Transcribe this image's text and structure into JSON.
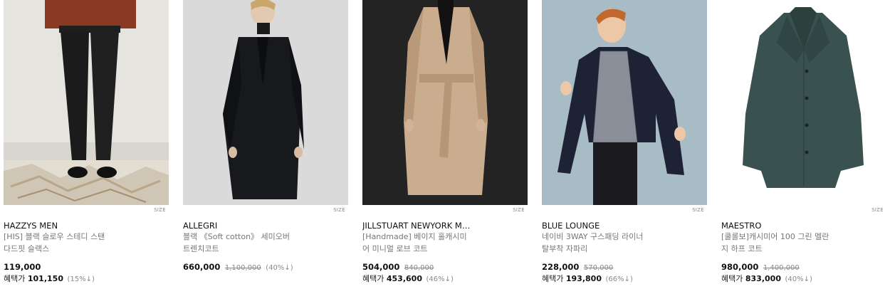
{
  "products": [
    {
      "brand": "HAZZYS MEN",
      "name_line1": "[HIS] 블랙 슬로우 스테디 스탠",
      "name_line2": "다드핏 슬랙스",
      "price": "119,000",
      "original_price": "",
      "discount_rate": "",
      "benefit_label": "혜택가",
      "benefit_price": "101,150",
      "benefit_rate": "(15%↓)",
      "size_tag": "SIZE",
      "image_bg": "#e7e5e0"
    },
    {
      "brand": "ALLEGRI",
      "name_line1": "블랙 《Soft cotton》 세미오버",
      "name_line2": "트렌치코트",
      "price": "660,000",
      "original_price": "1,100,000",
      "discount_rate": "(40%↓)",
      "benefit_label": "",
      "benefit_price": "",
      "benefit_rate": "",
      "size_tag": "SIZE",
      "image_bg": "#d8d9d8"
    },
    {
      "brand": "JILLSTUART NEWYORK M…",
      "name_line1": "[Handmade] 베이지 홀캐시미",
      "name_line2": "어 미니멀 로브 코트",
      "price": "504,000",
      "original_price": "840,000",
      "discount_rate": "",
      "benefit_label": "혜택가",
      "benefit_price": "453,600",
      "benefit_rate": "(46%↓)",
      "size_tag": "SIZE",
      "image_bg": "#222222"
    },
    {
      "brand": "BLUE LOUNGE",
      "name_line1": "네이비 3WAY 구스패딩 라이너",
      "name_line2": "탈부착 자파리",
      "price": "228,000",
      "original_price": "570,000",
      "discount_rate": "",
      "benefit_label": "혜택가",
      "benefit_price": "193,800",
      "benefit_rate": "(66%↓)",
      "size_tag": "SIZE",
      "image_bg": "#a9bdc6"
    },
    {
      "brand": "MAESTRO",
      "name_line1": "[쿨롤보]캐시미어 100 그린 멜란",
      "name_line2": "지 하프 코트",
      "price": "980,000",
      "original_price": "1,400,000",
      "discount_rate": "",
      "benefit_label": "혜택가",
      "benefit_price": "833,000",
      "benefit_rate": "(40%↓)",
      "size_tag": "SIZE",
      "image_bg": "#ffffff"
    }
  ]
}
